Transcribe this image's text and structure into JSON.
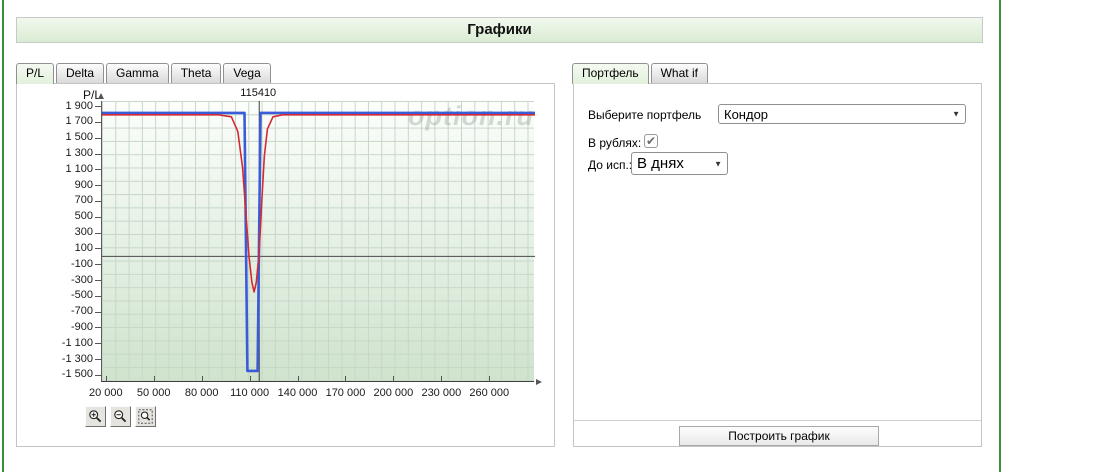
{
  "header": {
    "title": "Графики"
  },
  "left_tabs": [
    {
      "label": "P/L",
      "active": true
    },
    {
      "label": "Delta",
      "active": false
    },
    {
      "label": "Gamma",
      "active": false
    },
    {
      "label": "Theta",
      "active": false
    },
    {
      "label": "Vega",
      "active": false
    }
  ],
  "right_tabs": [
    {
      "label": "Портфель",
      "active": true
    },
    {
      "label": "What if",
      "active": false
    }
  ],
  "chart_data": {
    "type": "line",
    "ylabel": "P/L",
    "watermark": "option.ru",
    "marker_x": 115410,
    "marker_label": "115410",
    "xlim": [
      17000,
      288000
    ],
    "ylim": [
      -1590,
      1965
    ],
    "x_ticks": [
      20000,
      50000,
      80000,
      110000,
      140000,
      170000,
      200000,
      230000,
      260000
    ],
    "y_ticks": [
      1900,
      1700,
      1500,
      1300,
      1100,
      900,
      700,
      500,
      300,
      100,
      -100,
      -300,
      -500,
      -700,
      -900,
      -1100,
      -1300,
      -1500
    ],
    "zero_line": 0,
    "grid": true,
    "series": [
      {
        "name": "expiration-pl",
        "color": "#3b5cd9",
        "width": 2.6,
        "points": [
          [
            17000,
            1815
          ],
          [
            106200,
            1815
          ],
          [
            108000,
            -1450
          ],
          [
            114400,
            -1450
          ],
          [
            116200,
            1815
          ],
          [
            288000,
            1815
          ]
        ]
      },
      {
        "name": "current-pl",
        "color": "#d42a33",
        "width": 1.6,
        "points": [
          [
            17000,
            1790
          ],
          [
            90000,
            1790
          ],
          [
            98000,
            1765
          ],
          [
            102000,
            1580
          ],
          [
            105000,
            1120
          ],
          [
            107000,
            560
          ],
          [
            109000,
            0
          ],
          [
            110800,
            -330
          ],
          [
            112200,
            -450
          ],
          [
            113600,
            -330
          ],
          [
            115400,
            60
          ],
          [
            117000,
            700
          ],
          [
            118600,
            1260
          ],
          [
            120500,
            1610
          ],
          [
            124000,
            1765
          ],
          [
            130000,
            1790
          ],
          [
            288000,
            1790
          ]
        ]
      }
    ]
  },
  "zoom_toolbar": {
    "zoom_in_icon": "magnifier-plus",
    "zoom_out_icon": "magnifier-minus",
    "zoom_region_icon": "magnifier-region"
  },
  "form": {
    "portfolio_label": "Выберите портфель",
    "portfolio_value": "Кондор",
    "rubles_label": "В рублях:",
    "rubles_checked": true,
    "days_label": "До исп.:",
    "days_value": "В днях",
    "build_button": "Построить график",
    "dropdown_icon": "chevron-down",
    "check_icon": "check"
  },
  "colors": {
    "edge_green": "#35923a",
    "header_bg_top": "#f2f9ee",
    "header_bg_bottom": "#d9ecd3",
    "active_tab_bg": "#e9f6e2",
    "plot_bg_bottom": "#cfe3cd",
    "grid_line": "#c7d6c9",
    "series_expiration": "#3b5cd9",
    "series_current": "#d42a33"
  }
}
